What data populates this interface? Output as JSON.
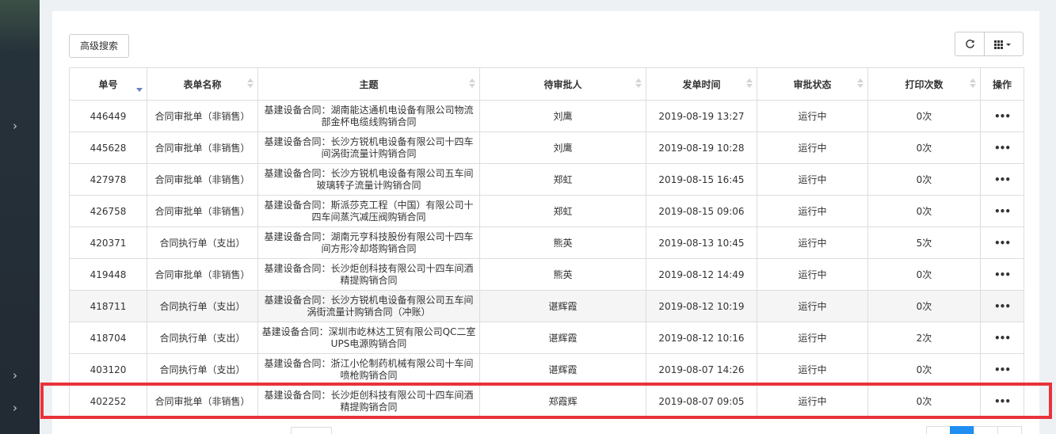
{
  "toolbar": {
    "advanced_search_label": "高级搜索",
    "refresh_icon": "refresh-icon",
    "columns_icon": "grid-columns-icon"
  },
  "table": {
    "headers": [
      "单号",
      "表单名称",
      "主题",
      "待审批人",
      "发单时间",
      "审批状态",
      "打印次数",
      "操作"
    ],
    "sorted_column": "单号",
    "ops_label": "•••",
    "rows": [
      {
        "id": "446449",
        "form": "合同审批单（非销售）",
        "subject": "基建设备合同：湖南能达通机电设备有限公司物流部金杯电缆线购销合同",
        "approver": "刘鹰",
        "time": "2019-08-19 13:27",
        "status": "运行中",
        "prints": "0次"
      },
      {
        "id": "445628",
        "form": "合同审批单（非销售）",
        "subject": "基建设备合同：长沙方锐机电设备有限公司十四车间涡街流量计购销合同",
        "approver": "刘鹰",
        "time": "2019-08-19 10:28",
        "status": "运行中",
        "prints": "0次"
      },
      {
        "id": "427978",
        "form": "合同审批单（非销售）",
        "subject": "基建设备合同：长沙方锐机电设备有限公司五车间玻璃转子流量计购销合同",
        "approver": "郑虹",
        "time": "2019-08-15 16:45",
        "status": "运行中",
        "prints": "0次"
      },
      {
        "id": "426758",
        "form": "合同审批单（非销售）",
        "subject": "基建设备合同：斯派莎克工程（中国）有限公司十四车间蒸汽减压阀购销合同",
        "approver": "郑虹",
        "time": "2019-08-15 09:06",
        "status": "运行中",
        "prints": "0次"
      },
      {
        "id": "420371",
        "form": "合同执行单（支出）",
        "subject": "基建设备合同：湖南元亨科技股份有限公司十四车间方形冷却塔购销合同",
        "approver": "熊英",
        "time": "2019-08-13 10:45",
        "status": "运行中",
        "prints": "5次"
      },
      {
        "id": "419448",
        "form": "合同审批单（非销售）",
        "subject": "基建设备合同：长沙炬创科技有限公司十四车间酒精提购销合同",
        "approver": "熊英",
        "time": "2019-08-12 14:49",
        "status": "运行中",
        "prints": "0次"
      },
      {
        "id": "418711",
        "form": "合同执行单（支出）",
        "subject": "基建设备合同：长沙方锐机电设备有限公司五车间涡街流量计购销合同（冲账）",
        "approver": "谌辉霞",
        "time": "2019-08-12 10:19",
        "status": "运行中",
        "prints": "0次"
      },
      {
        "id": "418704",
        "form": "合同执行单（支出）",
        "subject": "基建设备合同：深圳市屹林达工贸有限公司QC二室UPS电源购销合同",
        "approver": "谌辉霞",
        "time": "2019-08-12 10:16",
        "status": "运行中",
        "prints": "2次"
      },
      {
        "id": "403120",
        "form": "合同执行单（支出）",
        "subject": "基建设备合同：浙江小伦制药机械有限公司十车间喷枪购销合同",
        "approver": "谌辉霞",
        "time": "2019-08-07 14:26",
        "status": "运行中",
        "prints": "0次"
      },
      {
        "id": "402252",
        "form": "合同审批单（非销售）",
        "subject": "基建设备合同：长沙炬创科技有限公司十四车间酒精提购销合同",
        "approver": "郑霞辉",
        "time": "2019-08-07 09:05",
        "status": "运行中",
        "prints": "0次"
      }
    ]
  },
  "sidebar": {
    "arrow_icon": "chevron-right-icon",
    "arrows": [
      "›",
      "›",
      "›"
    ]
  }
}
